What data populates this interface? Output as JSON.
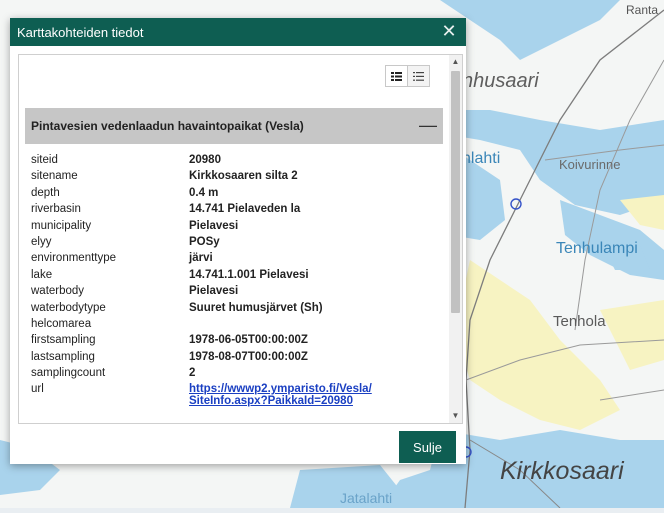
{
  "map": {
    "labels": {
      "ranta": "Ranta",
      "nhusaari": "nhusaari",
      "nlahti": "nlahti",
      "koivurinne": "Koivurinne",
      "tenhulampi": "Tenhulampi",
      "tenhola": "Tenhola",
      "kirkkosaari": "Kirkkosaari",
      "jatalahti": "Jatalahti"
    }
  },
  "dialog": {
    "title": "Karttakohteiden tiedot",
    "close_glyph": "✕",
    "section": {
      "title": "Pintavesien vedenlaadun havaintopaikat (Vesla)",
      "collapse_glyph": "—"
    },
    "properties": [
      {
        "key": "siteid",
        "value": "20980"
      },
      {
        "key": "sitename",
        "value": "Kirkkosaaren silta 2"
      },
      {
        "key": "depth",
        "value": "0.4 m"
      },
      {
        "key": "riverbasin",
        "value": "14.741 Pielaveden la"
      },
      {
        "key": "municipality",
        "value": "Pielavesi"
      },
      {
        "key": "elyy",
        "value": "POSy"
      },
      {
        "key": "environmenttype",
        "value": "järvi"
      },
      {
        "key": "lake",
        "value": "14.741.1.001 Pielavesi"
      },
      {
        "key": "waterbody",
        "value": "Pielavesi"
      },
      {
        "key": "waterbodytype",
        "value": "Suuret humusjärvet (Sh)"
      },
      {
        "key": "helcomarea",
        "value": ""
      },
      {
        "key": "firstsampling",
        "value": "1978-06-05T00:00:00Z"
      },
      {
        "key": "lastsampling",
        "value": "1978-08-07T00:00:00Z"
      },
      {
        "key": "samplingcount",
        "value": "2"
      }
    ],
    "url_row": {
      "key": "url",
      "link_line1": "https://wwwp2.ymparisto.fi/Vesla/",
      "link_line2": "SiteInfo.aspx?PaikkaId=20980"
    },
    "close_button_label": "Sulje"
  },
  "colors": {
    "header_green": "#0e5e52",
    "section_gray": "#c6c6c6",
    "link_blue": "#1a3fc2",
    "map_water": "#a9d3ec",
    "map_field": "#f7f3c2"
  },
  "icons": [
    "close-icon",
    "list-compact-icon",
    "list-detailed-icon",
    "collapse-icon",
    "scroll-up-icon",
    "scroll-down-icon"
  ]
}
